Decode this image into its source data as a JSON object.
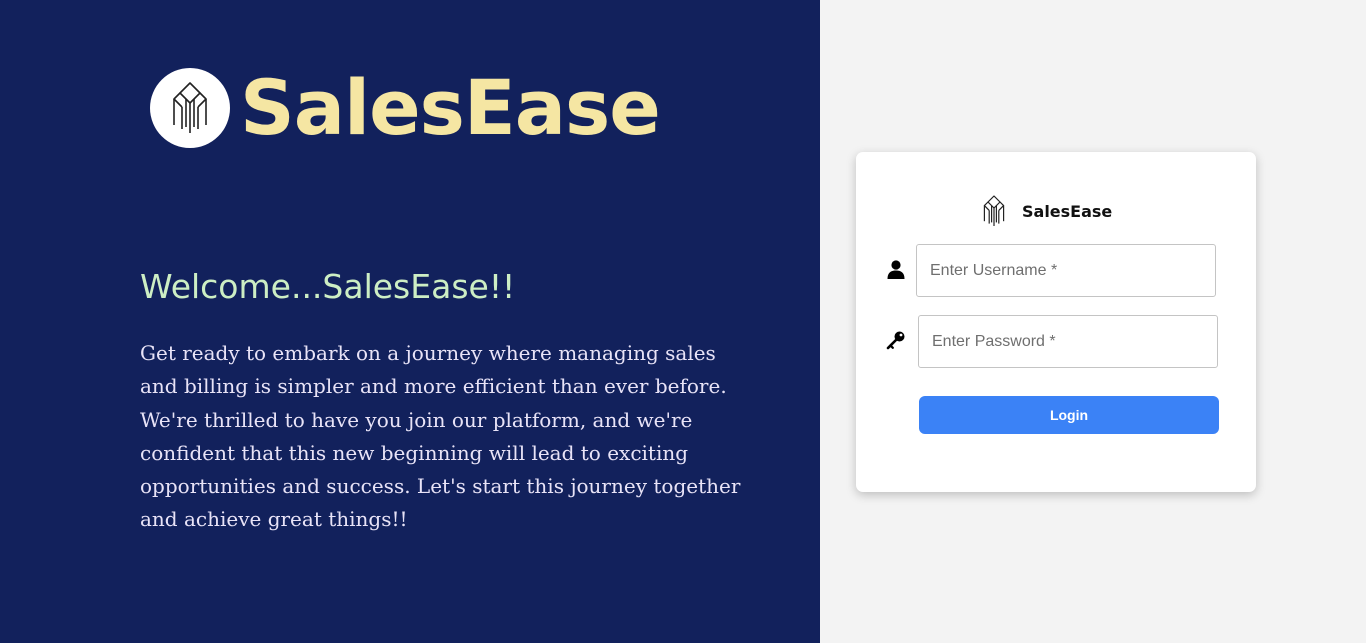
{
  "brand": {
    "name": "SalesEase",
    "logo_icon": "building-icon"
  },
  "welcome": {
    "title": "Welcome...SalesEase!!",
    "text": "Get ready to embark on a journey where managing sales and billing is simpler and more efficient than ever before. We're thrilled to have you join our platform, and we're confident that this new beginning will lead to exciting opportunities and success. Let's start this journey together and achieve great things!!"
  },
  "login_card": {
    "brand_name": "SalesEase",
    "username": {
      "icon": "user-icon",
      "placeholder": "Enter Username *",
      "value": ""
    },
    "password": {
      "icon": "key-icon",
      "placeholder": "Enter Password *",
      "value": ""
    },
    "login_label": "Login"
  },
  "colors": {
    "left_panel_bg": "#12215c",
    "brand_text": "#f5e6a3",
    "welcome_title": "#cdeec4",
    "welcome_text": "#e8e3f7",
    "page_bg": "#f3f3f3",
    "button_bg": "#3b82f6"
  }
}
